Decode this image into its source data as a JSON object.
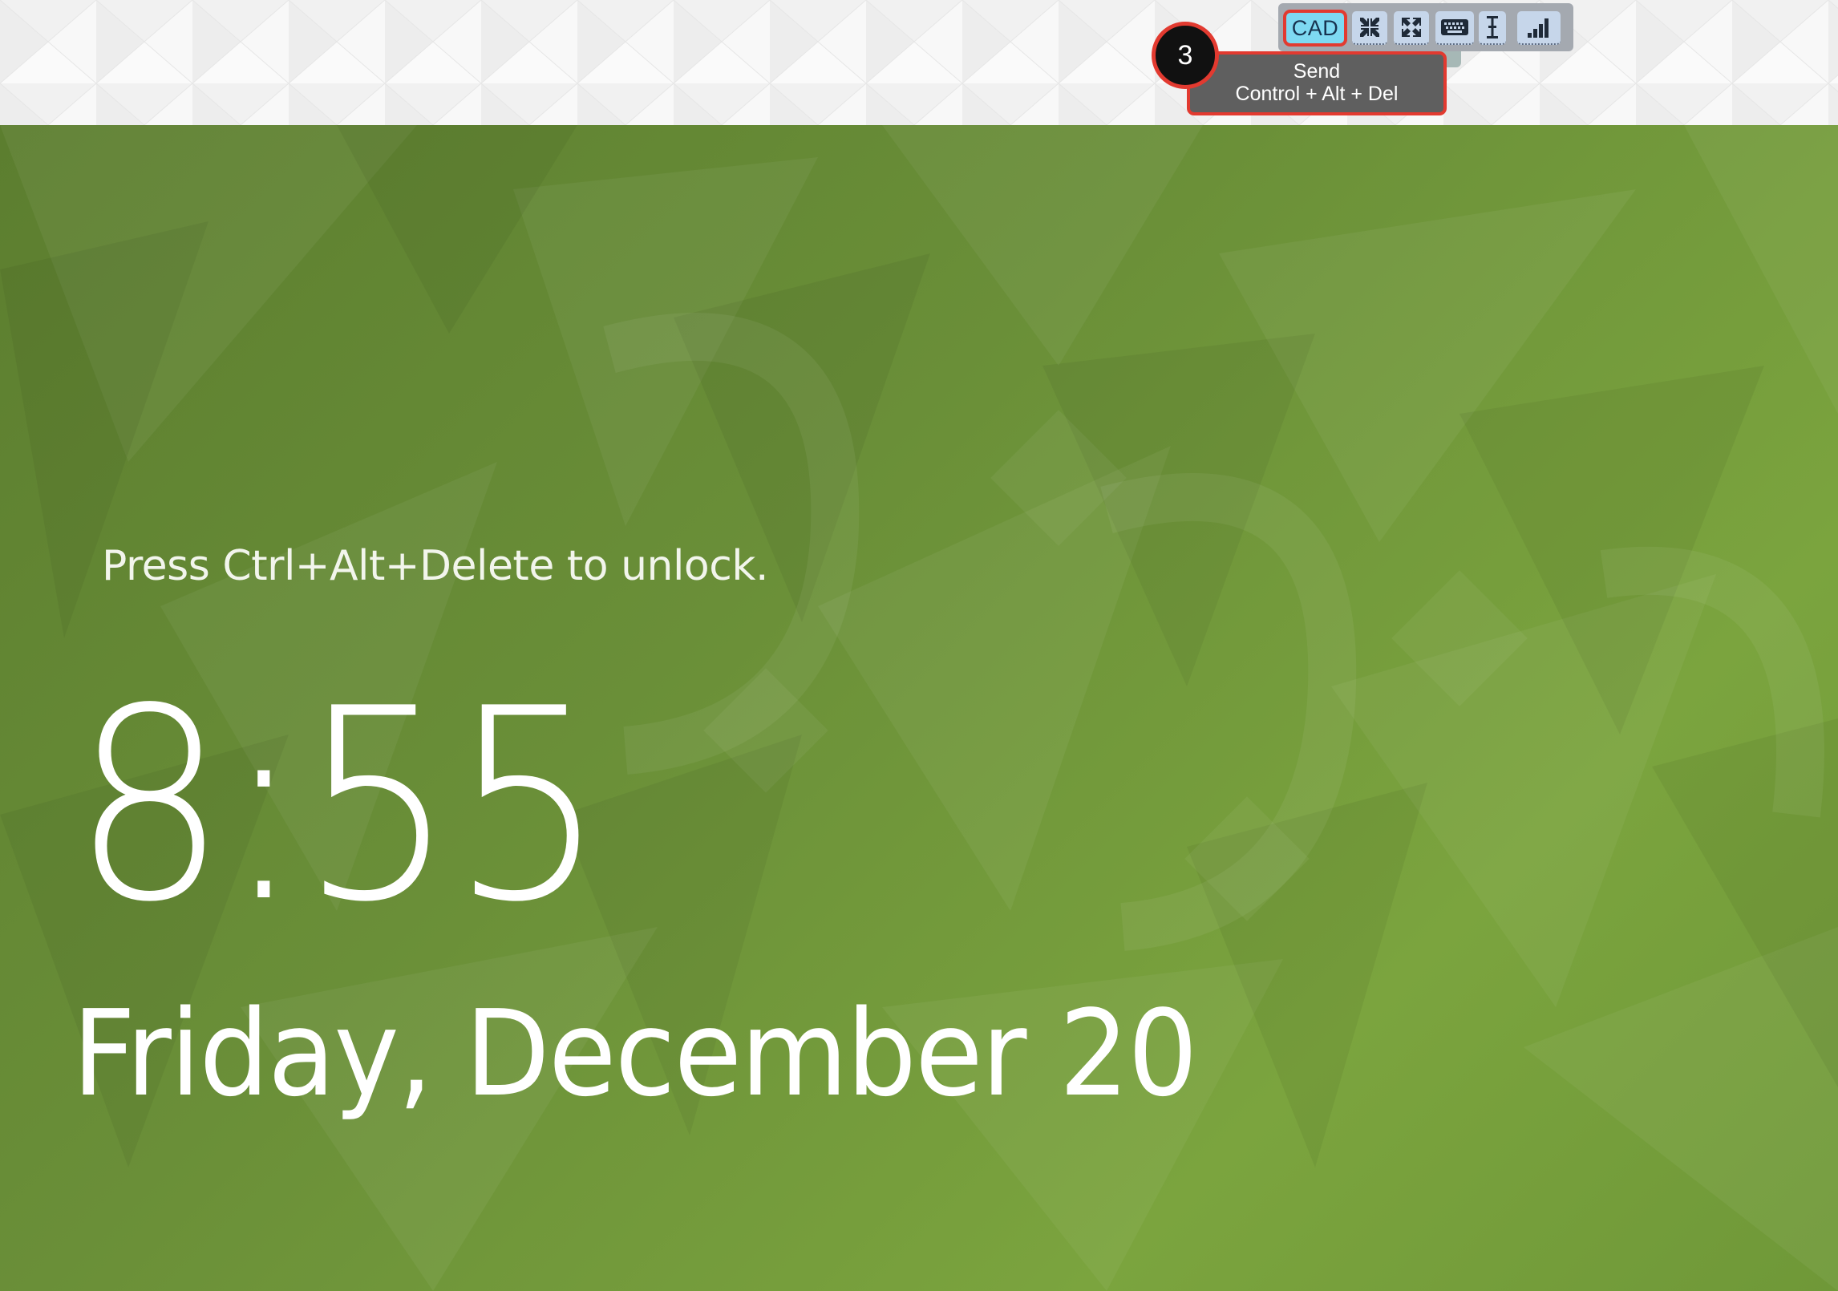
{
  "toolbar": {
    "cad_label": "CAD",
    "buttons": [
      {
        "name": "collapse-icon"
      },
      {
        "name": "fullscreen-icon"
      },
      {
        "name": "keyboard-icon"
      },
      {
        "name": "text-cursor-icon"
      },
      {
        "name": "signal-strength-icon"
      }
    ]
  },
  "tooltip": {
    "line1": "Send",
    "line2": "Control + Alt + Del"
  },
  "step_marker": {
    "label": "3"
  },
  "lock_screen": {
    "unlock_hint": "Press Ctrl+Alt+Delete to unlock.",
    "time": "8:55",
    "date": "Friday, December 20"
  },
  "colors": {
    "lock_background": "#6a8e37",
    "highlight_red": "#e23a30",
    "cad_button": "#7ed9f2",
    "tooltip_bg": "#5f5f5f"
  }
}
